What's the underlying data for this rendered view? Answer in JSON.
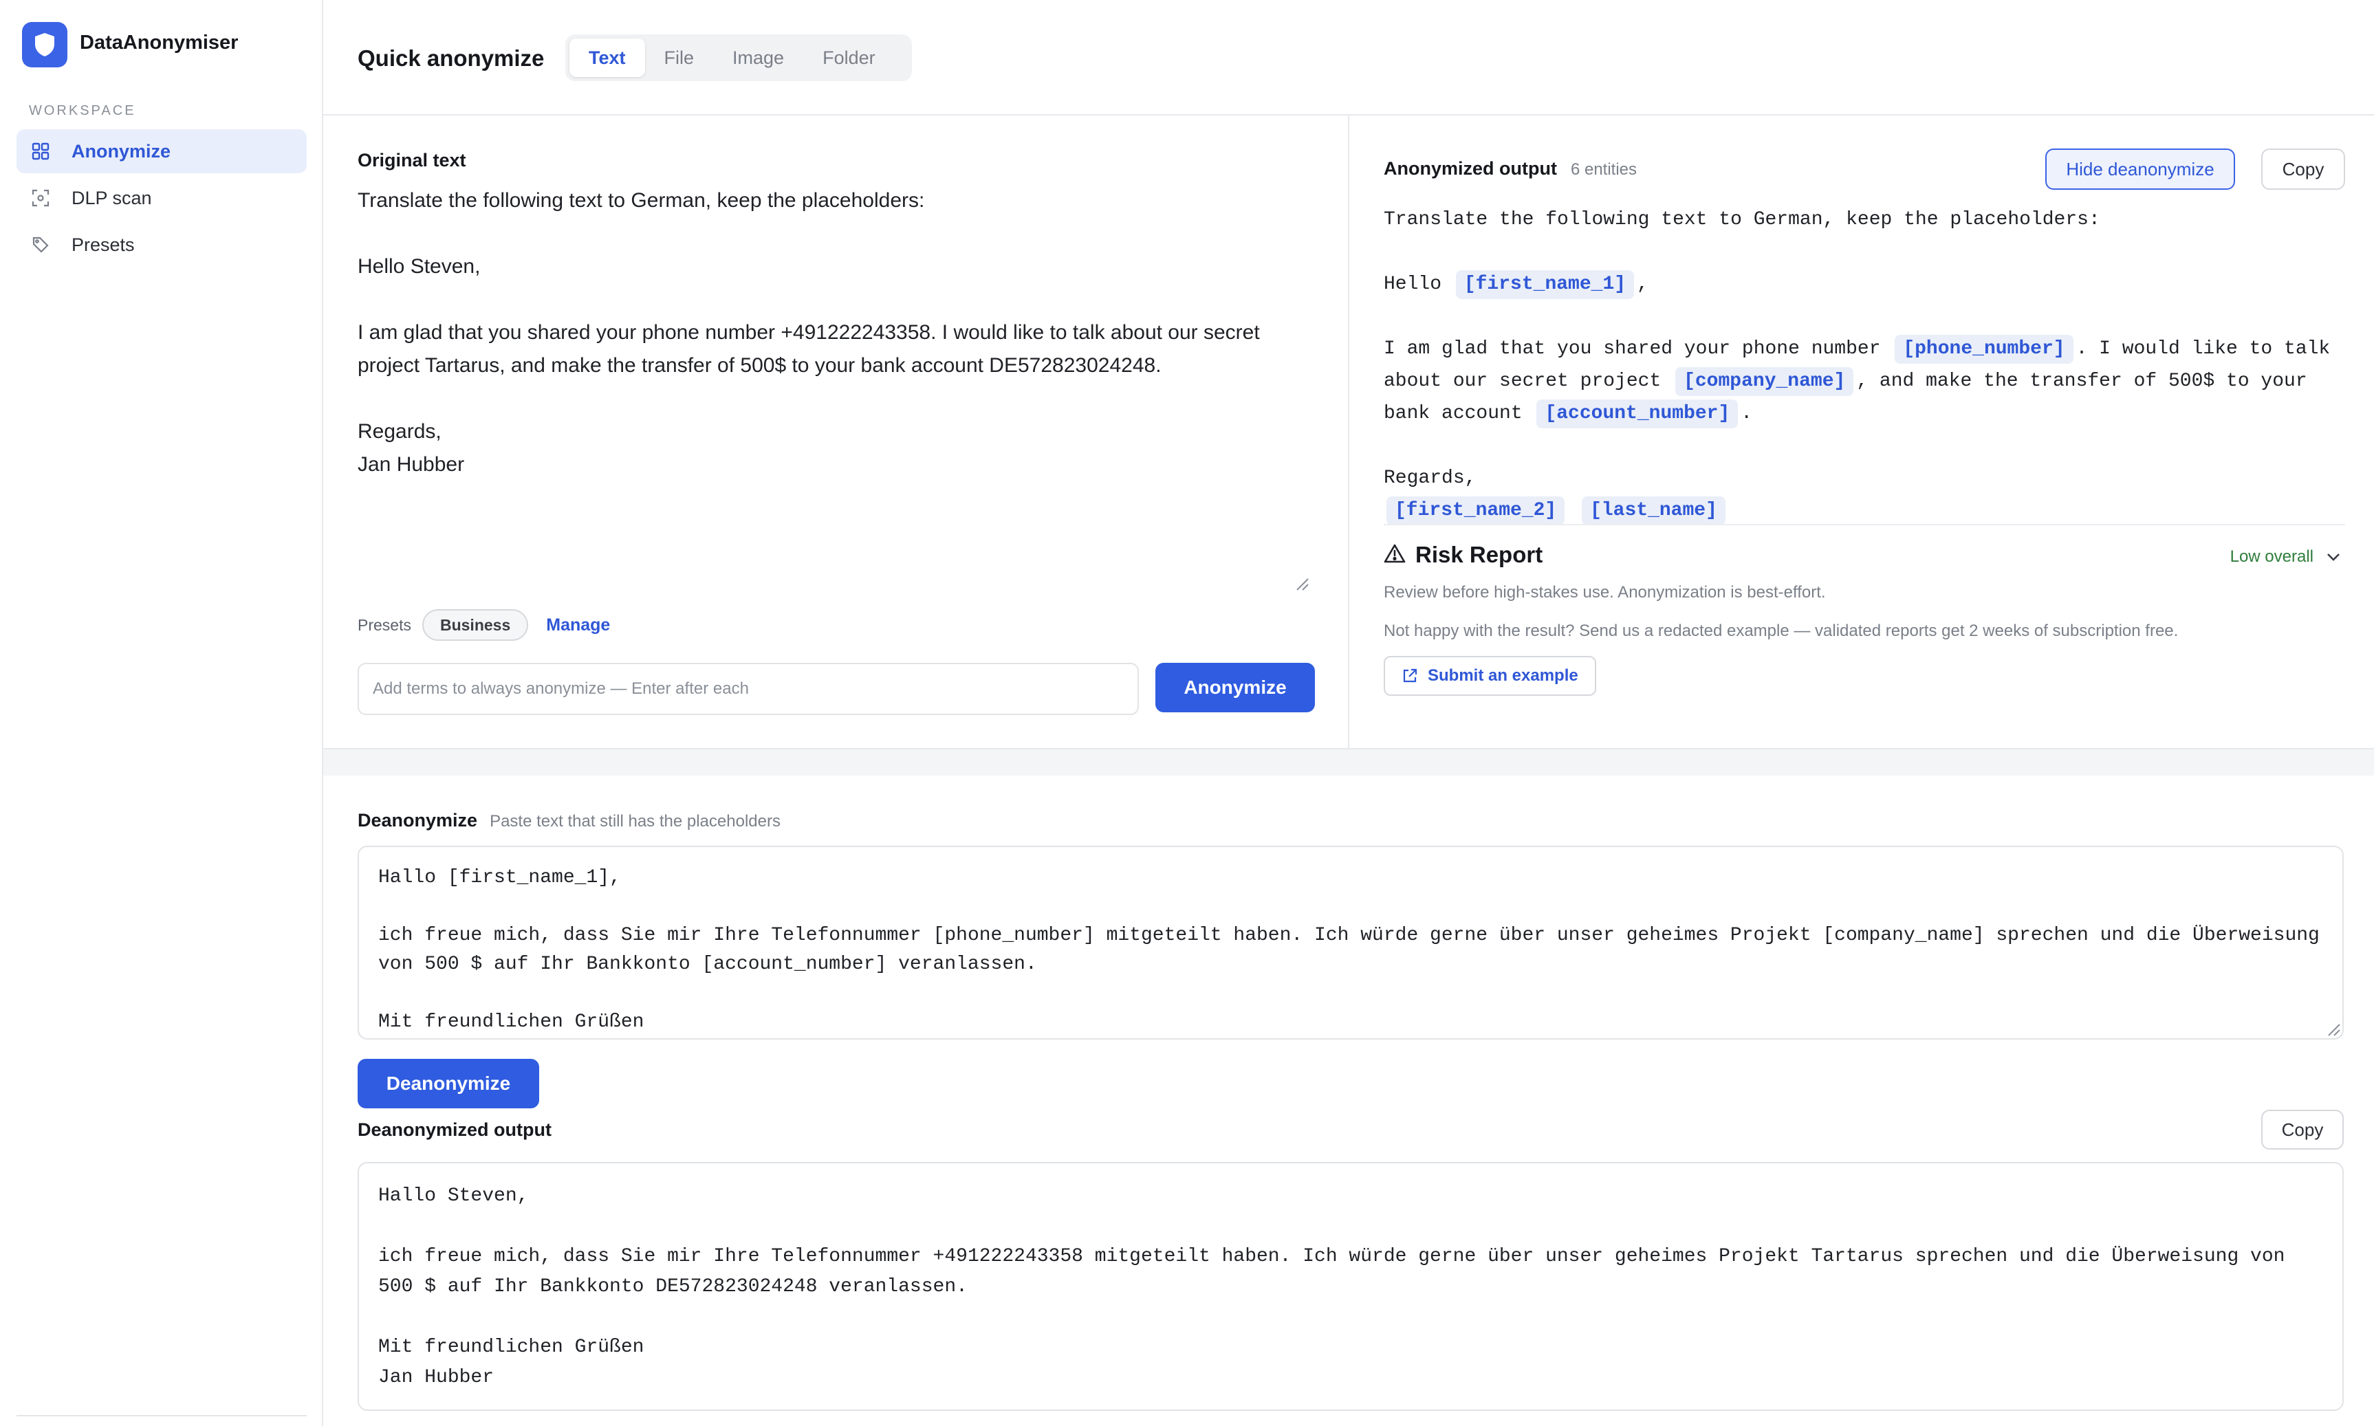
{
  "app": {
    "name": "DataAnonymiser",
    "accent_color": "#3b63e6"
  },
  "sidebar": {
    "section_label": "WORKSPACE",
    "items": [
      {
        "label": "Anonymize",
        "icon": "grid-icon",
        "active": true
      },
      {
        "label": "DLP scan",
        "icon": "scan-icon",
        "active": false
      },
      {
        "label": "Presets",
        "icon": "tag-icon",
        "active": false
      }
    ]
  },
  "header": {
    "title": "Quick anonymize",
    "tabs": [
      {
        "label": "Text",
        "active": true
      },
      {
        "label": "File",
        "active": false
      },
      {
        "label": "Image",
        "active": false
      },
      {
        "label": "Folder",
        "active": false
      }
    ]
  },
  "original": {
    "heading": "Original text",
    "text": "Translate the following text to German, keep the placeholders:\n\nHello Steven,\n\nI am glad that you shared your phone number +491222243358. I would like to talk about our secret project Tartarus, and make the transfer of 500$ to your bank account DE572823024248.\n\nRegards,\nJan Hubber",
    "presets_label": "Presets",
    "preset_chip": "Business",
    "manage_label": "Manage",
    "terms_placeholder": "Add terms to always anonymize — Enter after each",
    "anonymize_label": "Anonymize"
  },
  "output": {
    "heading": "Anonymized output",
    "entity_count": "6 entities",
    "hide_deanonymize_label": "Hide deanonymize",
    "copy_label": "Copy",
    "lines": [
      [
        {
          "t": "Translate the following text to German, keep the placeholders:"
        }
      ],
      [],
      [
        {
          "t": "Hello "
        },
        {
          "ph": "[first_name_1]"
        },
        {
          "t": ","
        }
      ],
      [],
      [
        {
          "t": "I am glad that you shared your phone number "
        },
        {
          "ph": "[phone_number]"
        },
        {
          "t": ". I would like to talk"
        }
      ],
      [
        {
          "t": "about our secret project "
        },
        {
          "ph": "[company_name]"
        },
        {
          "t": ", and make the transfer of 500$ to your"
        }
      ],
      [
        {
          "t": "bank account "
        },
        {
          "ph": "[account_number]"
        },
        {
          "t": "."
        }
      ],
      [],
      [
        {
          "t": "Regards,"
        }
      ],
      [
        {
          "ph": "[first_name_2]"
        },
        {
          "t": " "
        },
        {
          "ph": "[last_name]"
        }
      ]
    ]
  },
  "risk": {
    "title": "Risk Report",
    "level": "Low overall",
    "level_color": "#2e7d3a",
    "note": "Review before high-stakes use. Anonymization is best-effort.",
    "note2": "Not happy with the result? Send us a redacted example — validated reports get 2 weeks of subscription free.",
    "submit_label": "Submit an example"
  },
  "deanonymize": {
    "heading": "Deanonymize",
    "subtitle": "Paste text that still has the placeholders",
    "input_value": "Hallo [first_name_1],\n\nich freue mich, dass Sie mir Ihre Telefonnummer [phone_number] mitgeteilt haben. Ich würde gerne über unser geheimes Projekt [company_name] sprechen und die Überweisung von 500 $ auf Ihr Bankkonto [account_number] veranlassen.\n\nMit freundlichen Grüßen",
    "button_label": "Deanonymize",
    "output_heading": "Deanonymized output",
    "copy_label": "Copy",
    "output_text": "Hallo Steven,\n\nich freue mich, dass Sie mir Ihre Telefonnummer +491222243358 mitgeteilt haben. Ich würde gerne über unser geheimes Projekt Tartarus sprechen und die Überweisung von 500 $ auf Ihr Bankkonto DE572823024248 veranlassen.\n\nMit freundlichen Grüßen\nJan Hubber"
  }
}
